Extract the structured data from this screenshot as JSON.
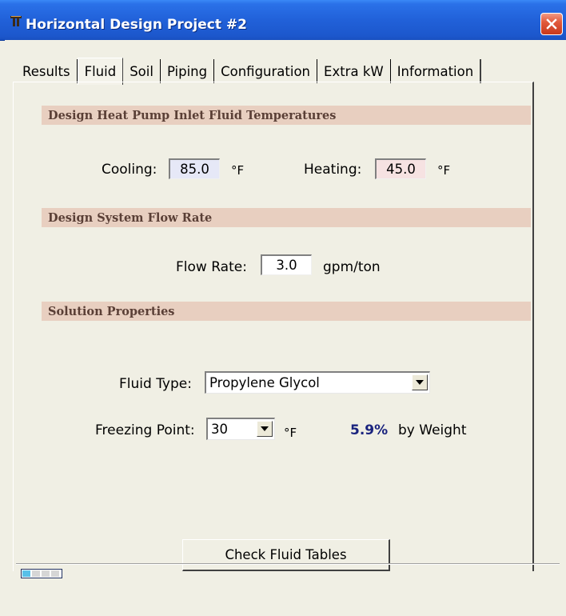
{
  "window": {
    "title": "Horizontal Design Project #2",
    "title_bar_color": "#2161d9",
    "close_icon": "close-icon",
    "app_icon": "app-icon"
  },
  "tabs": [
    {
      "label": "Results",
      "active": false
    },
    {
      "label": "Fluid",
      "active": true
    },
    {
      "label": "Soil",
      "active": false
    },
    {
      "label": "Piping",
      "active": false
    },
    {
      "label": "Configuration",
      "active": false
    },
    {
      "label": "Extra kW",
      "active": false
    },
    {
      "label": "Information",
      "active": false
    }
  ],
  "temps": {
    "section_title": "Design Heat Pump Inlet Fluid Temperatures",
    "cooling_label": "Cooling:",
    "cooling_value": "85.0",
    "cooling_unit": "°F",
    "cooling_color": "#e6e8f7",
    "heating_label": "Heating:",
    "heating_value": "45.0",
    "heating_unit": "°F",
    "heating_color": "#f6e2e2"
  },
  "flow": {
    "section_title": "Design System Flow Rate",
    "label": "Flow Rate:",
    "value": "3.0",
    "unit": "gpm/ton"
  },
  "solution": {
    "section_title": "Solution Properties",
    "fluid_type_label": "Fluid Type:",
    "fluid_type_value": "Propylene Glycol",
    "freezing_label": "Freezing Point:",
    "freezing_value": "30",
    "freezing_unit": "°F",
    "percent": "5.9%",
    "percent_suffix": "by Weight",
    "percent_color": "#1a237e"
  },
  "actions": {
    "check_tables_label": "Check Fluid Tables"
  },
  "status": {
    "progress_icon": "progress-indicator",
    "progress_fraction": 0.25
  },
  "colors": {
    "section_bar": "#e8cfc0",
    "window_bg": "#f0efe4"
  }
}
